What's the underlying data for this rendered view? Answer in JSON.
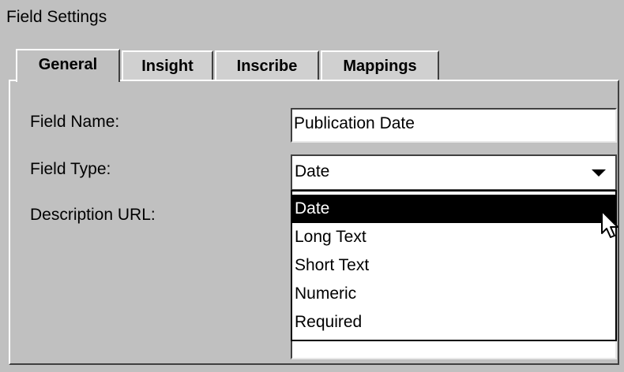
{
  "panel": {
    "title": "Field Settings"
  },
  "tabs": [
    {
      "label": "General",
      "active": true
    },
    {
      "label": "Insight",
      "active": false
    },
    {
      "label": "Inscribe",
      "active": false
    },
    {
      "label": "Mappings",
      "active": false
    }
  ],
  "form": {
    "field_name_label": "Field Name:",
    "field_name_value": "Publication Date",
    "field_type_label": "Field Type:",
    "field_type_value": "Date",
    "description_url_label": "Description URL:",
    "description_url_value": ""
  },
  "dropdown": {
    "options": [
      "Date",
      "Long Text",
      "Short Text",
      "Numeric",
      "Required"
    ],
    "selected": "Date"
  },
  "colors": {
    "panel_bg": "#c0c0c0",
    "selection_bg": "#000000",
    "selection_fg": "#ffffff"
  },
  "icons": {
    "combo_arrow": "chevron-down-icon",
    "cursor": "mouse-pointer-icon"
  }
}
